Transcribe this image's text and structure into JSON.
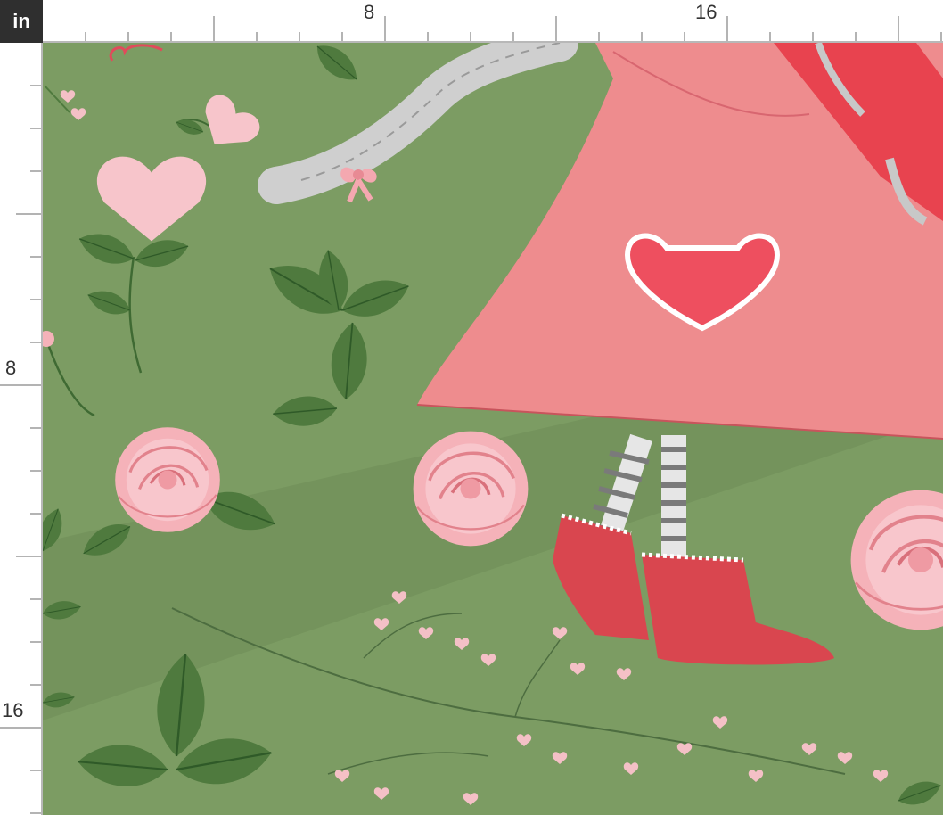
{
  "ruler": {
    "unit": "in",
    "horizontal_labels": [
      "8",
      "16"
    ],
    "vertical_labels": [
      "8",
      "16"
    ]
  },
  "colors": {
    "background_green": "#7c9c63",
    "dress_pink": "#ee8c8e",
    "boot_red": "#d9464f",
    "rose_pink": "#f6b9bf",
    "leaf_green": "#4f7a3e",
    "heart_pink": "#f7c5cb"
  },
  "artwork": {
    "icons": [
      "ruler-unit",
      "braid-icon",
      "bow-icon",
      "heart-icon",
      "rose-icon",
      "leaf-icon",
      "boot-icon"
    ]
  }
}
